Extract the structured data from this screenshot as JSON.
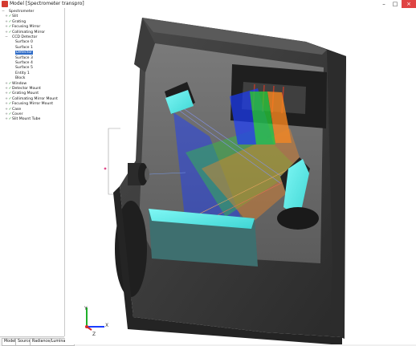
{
  "window": {
    "title": "Model [Spectrometer transpro]",
    "min": "–",
    "max": "□",
    "close": "×"
  },
  "tree": {
    "items": [
      {
        "label": "Spectrometer",
        "indent": 0,
        "check": false,
        "expand": "−"
      },
      {
        "label": "Slit",
        "indent": 1,
        "check": true,
        "expand": "+"
      },
      {
        "label": "Grating",
        "indent": 1,
        "check": true,
        "expand": "+"
      },
      {
        "label": "Focusing Mirror",
        "indent": 1,
        "check": true,
        "expand": "+"
      },
      {
        "label": "Collimating Mirror",
        "indent": 1,
        "check": true,
        "expand": "+"
      },
      {
        "label": "CCD Detector",
        "indent": 1,
        "check": false,
        "expand": "−"
      },
      {
        "label": "Surface 0",
        "indent": 2,
        "check": false,
        "expand": ""
      },
      {
        "label": "Surface 1",
        "indent": 2,
        "check": false,
        "expand": ""
      },
      {
        "label": "Detector",
        "indent": 2,
        "check": false,
        "expand": "",
        "selected": true
      },
      {
        "label": "Surface 3",
        "indent": 2,
        "check": false,
        "expand": ""
      },
      {
        "label": "Surface 4",
        "indent": 2,
        "check": false,
        "expand": ""
      },
      {
        "label": "Surface 5",
        "indent": 2,
        "check": false,
        "expand": ""
      },
      {
        "label": "Entity 1",
        "indent": 2,
        "check": false,
        "expand": ""
      },
      {
        "label": "Block",
        "indent": 2,
        "check": false,
        "expand": ""
      },
      {
        "label": "Window",
        "indent": 1,
        "check": true,
        "expand": "+"
      },
      {
        "label": "Detector Mount",
        "indent": 1,
        "check": true,
        "expand": "+"
      },
      {
        "label": "Grating Mount",
        "indent": 1,
        "check": true,
        "expand": "+"
      },
      {
        "label": "Collimating Mirror Mount",
        "indent": 1,
        "check": true,
        "expand": "+"
      },
      {
        "label": "Focusing Mirror Mount",
        "indent": 1,
        "check": true,
        "expand": "+"
      },
      {
        "label": "Case",
        "indent": 1,
        "check": true,
        "expand": "+"
      },
      {
        "label": "Cover",
        "indent": 1,
        "check": true,
        "expand": "+"
      },
      {
        "label": "Slit Mount Tube",
        "indent": 1,
        "check": true,
        "expand": "+"
      }
    ]
  },
  "tabs": [
    "Model",
    "Source",
    "Radiance/Luminance"
  ],
  "axes": {
    "x": "X",
    "y": "Y",
    "z": "Z"
  },
  "colors": {
    "case": "#3a3a3a",
    "case_dark": "#262626",
    "cyan": "#5ff0ef",
    "ray_blue": "#1a3cff",
    "ray_green": "#27d43a",
    "ray_orange": "#ff8a1e"
  }
}
